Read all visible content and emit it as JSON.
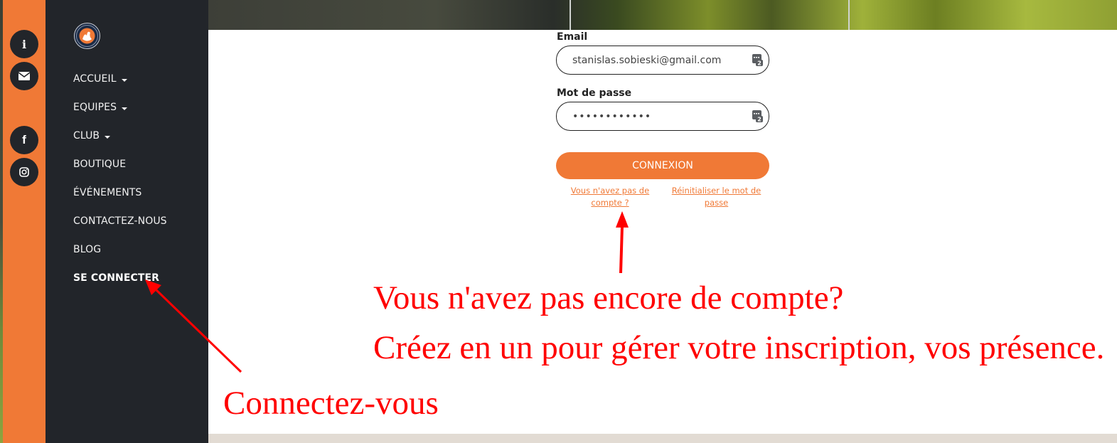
{
  "social_rail": {
    "buttons": [
      {
        "name": "info",
        "icon": "info-icon",
        "glyph": "i"
      },
      {
        "name": "email",
        "icon": "envelope-icon",
        "glyph": "✉"
      },
      {
        "name": "facebook",
        "icon": "facebook-icon",
        "glyph": "f"
      },
      {
        "name": "instagram",
        "icon": "instagram-icon",
        "glyph": "◎"
      }
    ]
  },
  "sidebar": {
    "logo_alt": "club-logo",
    "nav": [
      {
        "label": "ACCUEIL",
        "dropdown": true
      },
      {
        "label": "EQUIPES",
        "dropdown": true
      },
      {
        "label": "CLUB",
        "dropdown": true
      },
      {
        "label": "BOUTIQUE",
        "dropdown": false
      },
      {
        "label": "ÉVÉNEMENTS",
        "dropdown": false
      },
      {
        "label": "CONTACTEZ-NOUS",
        "dropdown": false
      },
      {
        "label": "BLOG",
        "dropdown": false
      },
      {
        "label": "SE CONNECTER",
        "dropdown": false,
        "active": true
      }
    ]
  },
  "login_form": {
    "email_label": "Email",
    "email_value": "stanislas.sobieski@gmail.com",
    "password_label": "Mot de passe",
    "password_value": "••••••••••••",
    "submit_label": "CONNEXION",
    "signup_link": "Vous n'avez pas de compte ?",
    "reset_link": "Réinitialiser le mot de passe"
  },
  "annotations": {
    "line1": "Vous n'avez pas encore de compte?",
    "line2": "Créez en un pour gérer votre inscription, vos présence.",
    "line3": "Connectez-vous"
  },
  "colors": {
    "accent": "#f07936",
    "sidebar_bg": "#22252a",
    "annotation": "#ff0000",
    "footer_band": "#e2dbd3"
  }
}
